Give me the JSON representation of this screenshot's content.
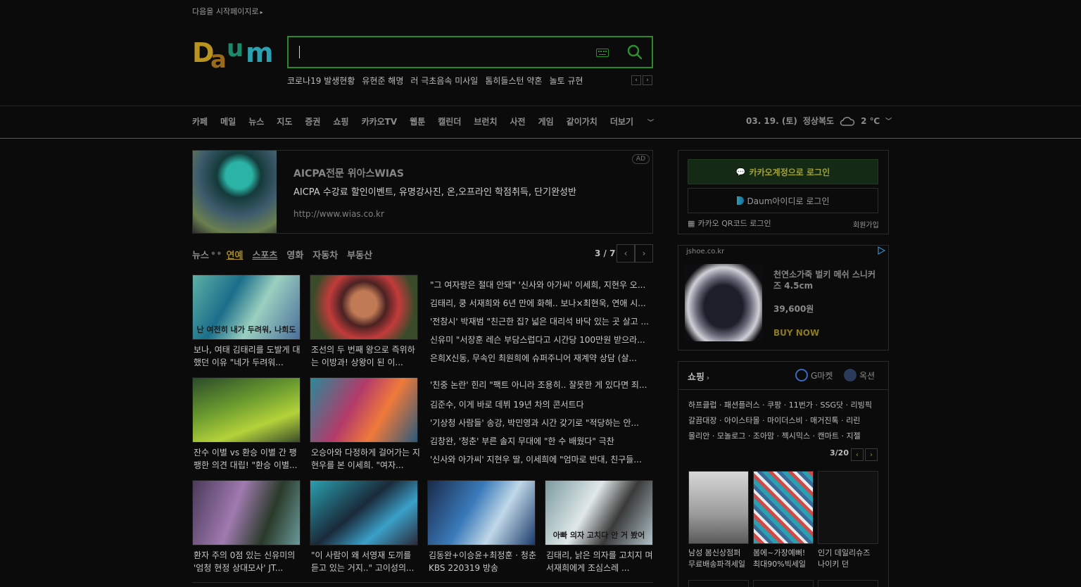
{
  "header": {
    "start_page": "다음을 시작페이지로",
    "logo_text": "Daum",
    "trending": [
      "코로나19 발생현황",
      "유현준 해명",
      "러 극초음속 미사일",
      "톰히들스턴 약혼",
      "놀토 규현"
    ]
  },
  "nav": {
    "items": [
      "카페",
      "메일",
      "뉴스",
      "지도",
      "증권",
      "쇼핑",
      "카카오TV",
      "웹툰",
      "캘린더",
      "브런치",
      "사전",
      "게임",
      "같이가치",
      "더보기"
    ],
    "date": "03. 19. (토)",
    "region": "정상복도",
    "temperature": "2 ℃"
  },
  "ad": {
    "badge": "AD",
    "title": "AICPA전문 위아스WIAS",
    "description": "AICPA 수강료 할인이벤트, 유명강사진, 온,오프라인 학점취득, 단기완성반",
    "url": "http://www.wias.co.kr"
  },
  "news": {
    "tabs": [
      "뉴스",
      "연예",
      "스포츠",
      "영화",
      "자동차",
      "부동산"
    ],
    "active_tab": "연예",
    "page": "3 / 7",
    "thumb_captions": [
      "난 여전히 내가 두려워, 나희도",
      "",
      "",
      "",
      "",
      "",
      "",
      "아빠 의자 고치다 안 거 봤어"
    ],
    "thumb_titles": [
      "보나, 여태 김태리를 도발게 대했던 이유 \"네가 두려워...",
      "조선의 두 번째 왕으로 즉위하는 이방과! 상왕이 된 이...",
      "잔수 이별 vs 환승 이별 간 팽팽한 의견 대립! \"환승 이별...",
      "오승아와 다정하게 걸어가는 지현우를 본 이세희. \"여자...",
      "환자 주의 0점 있는 신유미의 '엄청 현정 상대모사' JT...",
      "\"이 사람이 왜 서영재 도끼를 듣고 있는 거지..\" 고이성의...",
      "김동완+이승윤+최정훈 · 청춘 KBS 220319 방송",
      "김태리, 낡은 의자를 고치지 며 서재희에게 조심스레 ..."
    ],
    "headlines": [
      "\"그 여자랑은 절대 안돼\" '신사와 아가씨' 이세희, 지현우 오...",
      "김태리, 쿵 서재희와 6년 만에 화해.. 보나×최현욱, 연애 시...",
      "'전참시' 박재범 \"친근한 집? 넓은 대리석 바닥 있는 곳 살고 ...",
      "신유미 \"서장훈 레슨 부담스럽다고 시간당 100만원 받으라...",
      "은희X신동, 무속인 최원희에 슈퍼주니어 재계약 상담 (살...",
      "'친중 논란' 힌리 \"팩트 아니라 조용히.. 잘못한 게 있다면 죄...",
      "김준수, 이게 바로 데뷔 19년 차의 콘서트다",
      "'기상청 사람들' 송강, 박민영과 시간 갖기로 \"적당하는 안...",
      "김창완, '청춘' 부른 솔지 무대에 \"한 수 배웠다\" 극찬",
      "'신사와 아가씨' 지현우 딸, 이세희에 \"엄마로 반대, 친구들..."
    ]
  },
  "login": {
    "kakao": "카카오계정으로 로그인",
    "daum": "Daum아이디로 로그인",
    "qr": "카카오 QR코드 로그인",
    "signup": "회원가입"
  },
  "shop_ad": {
    "domain": "jshoe.co.kr",
    "name": "천연소가죽 벌키 메쉬 스니커즈 4.5cm",
    "price": "39,600원",
    "cta": "BUY NOW"
  },
  "shopping": {
    "title": "쇼핑",
    "gmarket": "G마켓",
    "auction": "옥션",
    "links": [
      "하프클럽 · 패션플러스 · 쿠팡 · 11번가 · SSG닷 · 리빙픽",
      "갈끔대장 · 아이스타몰 · 마이더스비 · 매거진톡 · 리린",
      "몰리안 · 모놀로그 · 조아맘 · 젝시믹스 · 캔마트 · 지젤"
    ],
    "page": "3/20",
    "products": [
      "남성 봄신상점퍼 무료배송파격세일",
      "봄에~가장예뻐! 최대90%빅세일",
      "인기 데일리슈즈 나이키 던"
    ]
  },
  "colors": {
    "accent_green": "#2a8a2a",
    "active_tab": "#a78b1f"
  }
}
